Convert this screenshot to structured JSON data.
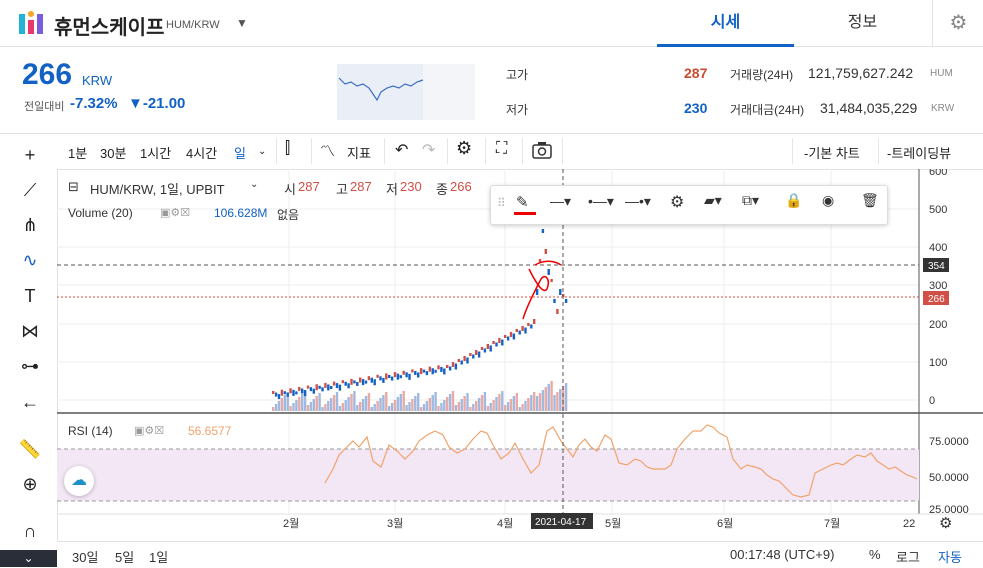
{
  "header": {
    "coin_name": "휴먼스케이프",
    "coin_symbol": "HUM/KRW",
    "tabs": [
      {
        "label": "시세",
        "active": true
      },
      {
        "label": "정보",
        "active": false
      }
    ],
    "accent": "#1261c4"
  },
  "summary": {
    "price": "266",
    "price_unit": "KRW",
    "prev_label": "전일대비",
    "change_pct": "-7.32%",
    "change_abs": "▼-21.00",
    "high_label": "고가",
    "high_value": "287",
    "low_label": "저가",
    "low_value": "230",
    "volume_label": "거래량(24H)",
    "volume_value": "121,759,627.242",
    "volume_unit": "HUM",
    "amount_label": "거래대금(24H)",
    "amount_value": "31,484,035,229",
    "amount_unit": "KRW"
  },
  "toolbar": {
    "intervals": [
      "1분",
      "30분",
      "1시간",
      "4시간",
      "일"
    ],
    "indicator_label": "지표",
    "basic_chart_label": "-기본 차트",
    "trading_view_label": "-트레이딩뷰"
  },
  "chart": {
    "legend_symbol": "HUM/KRW, 1일, UPBIT",
    "o_label": "시",
    "o_value": "287",
    "h_label": "고",
    "h_value": "287",
    "l_label": "저",
    "l_value": "230",
    "c_label": "종",
    "c_value": "266",
    "volume_legend": "Volume (20)",
    "volume_value": "106.628M",
    "volume_extra": "없음",
    "rsi_legend": "RSI (14)",
    "rsi_value": "56.6577",
    "crosshair_price": "354",
    "last_price_tag": "266",
    "crosshair_date": "2021-04-17",
    "colors": {
      "up": "#d24f45",
      "down": "#1261c4",
      "rsi": "#f0a36b",
      "rsi_band": "#f3e6f5"
    }
  },
  "chart_data": {
    "type": "line",
    "price_axis_ticks": [
      "600",
      "500",
      "400",
      "300",
      "200",
      "100",
      "0"
    ],
    "rsi_axis_ticks": [
      "75.0000",
      "50.0000",
      "25.0000"
    ],
    "time_axis_ticks": [
      "2월",
      "3월",
      "4월",
      "5월",
      "6월",
      "7월",
      "22"
    ]
  },
  "bottom": {
    "ranges": [
      "30일",
      "5일",
      "1일"
    ],
    "clock": "00:17:48 (UTC+9)",
    "percent_label": "%",
    "log_label": "로그",
    "auto_label": "자동"
  }
}
